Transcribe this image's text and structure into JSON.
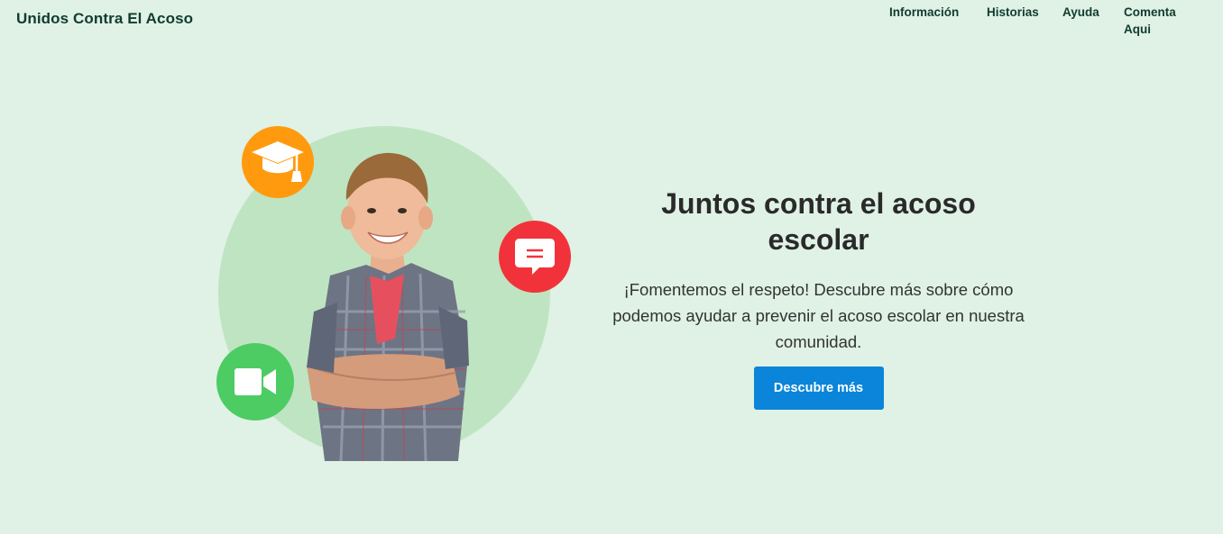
{
  "header": {
    "brand": "Unidos Contra El Acoso",
    "nav": [
      {
        "label": "Información"
      },
      {
        "label": "Historias"
      },
      {
        "label": "Ayuda"
      },
      {
        "label": "Comenta Aqui"
      }
    ]
  },
  "hero": {
    "title": "Juntos contra el acoso escolar",
    "subtitle": "¡Fomentemos el respeto! Descubre más sobre cómo podemos ayudar a prevenir el acoso escolar en nuestra comunidad.",
    "cta_label": "Descubre más",
    "icons": [
      "graduation-cap-icon",
      "chat-bubble-icon",
      "video-camera-icon"
    ]
  },
  "colors": {
    "background": "#dff2e5",
    "blob": "#bfe4c1",
    "cap_badge": "#ff9a0e",
    "chat_badge": "#f2323a",
    "video_badge": "#4ccc63",
    "cta": "#0a85d9",
    "text_dark": "#123b30"
  }
}
